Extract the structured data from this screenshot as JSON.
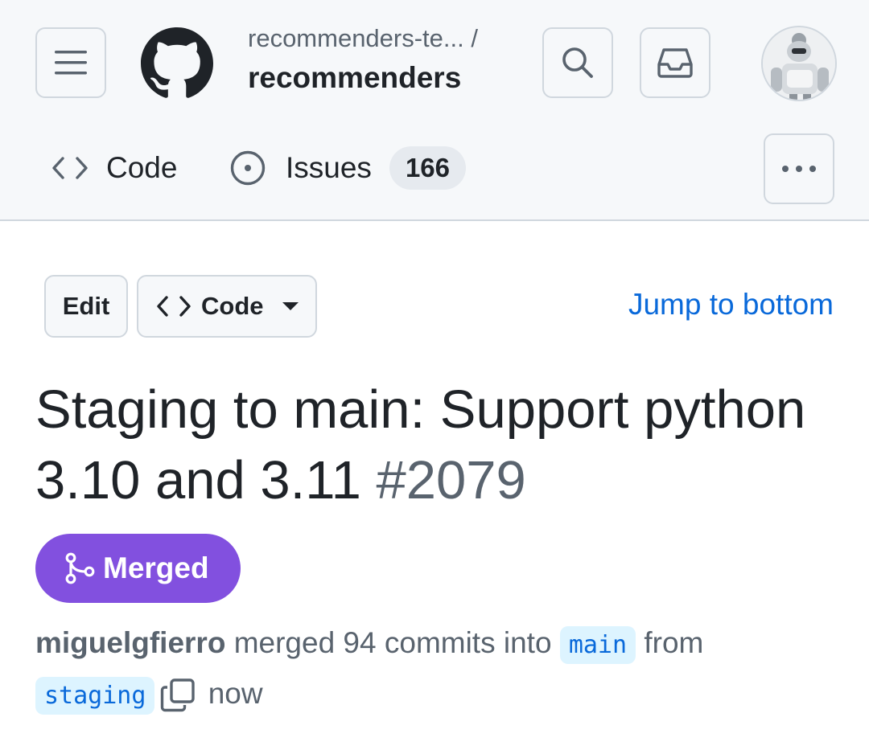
{
  "header": {
    "repo_owner": "recommenders-te... /",
    "repo_name": "recommenders",
    "icons": {
      "menu": "hamburger-icon",
      "logo": "github-mark-icon",
      "search": "search-icon",
      "inbox": "inbox-icon",
      "more": "kebab-horizontal-icon"
    }
  },
  "tabs": [
    {
      "label": "Code",
      "icon": "code-icon"
    },
    {
      "label": "Issues",
      "icon": "issue-opened-icon",
      "count": "166"
    }
  ],
  "actions": {
    "edit_label": "Edit",
    "code_label": "Code",
    "jump_label": "Jump to bottom"
  },
  "pull_request": {
    "title": "Staging to main: Support python 3.10 and 3.11",
    "number": "#2079",
    "state_label": "Merged",
    "author": "miguelgfierro",
    "merged_text": "merged 94 commits into",
    "base_branch": "main",
    "from_text": "from",
    "head_branch": "staging",
    "time": "now"
  },
  "colors": {
    "merged": "#8250df",
    "link": "#0969da",
    "header_bg": "#f6f8fa",
    "border": "#d0d7de",
    "branch_bg": "#ddf4ff"
  }
}
